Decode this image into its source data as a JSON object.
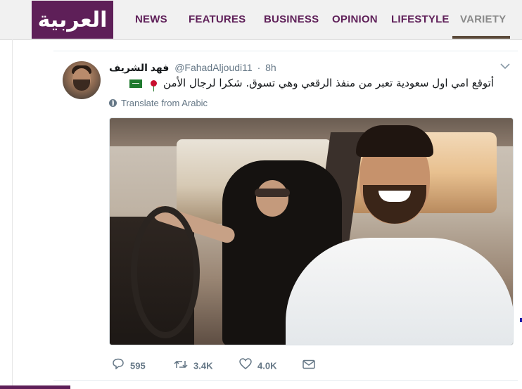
{
  "site": {
    "logo_text": "العربية",
    "brand_color": "#5e1f58"
  },
  "nav": {
    "items": [
      {
        "label": "NEWS"
      },
      {
        "label": "FEATURES"
      },
      {
        "label": "BUSINESS"
      },
      {
        "label": "OPINION"
      },
      {
        "label": "LIFESTYLE"
      },
      {
        "label": "VARIETY"
      }
    ],
    "active": "VARIETY"
  },
  "tweet": {
    "display_name": "فهد الشريف",
    "handle": "@FahadAljoudi11",
    "separator": "·",
    "time": "8h",
    "text": "أتوقع امي اول سعودية تعبر من منفذ الرقعي وهي تسوق. شكرا لرجال الأمن",
    "translate_label": "Translate from Arabic",
    "icons": {
      "caret": "chevron-down-icon",
      "emoji_rose": "rose-emoji",
      "emoji_flag": "saudi-flag-emoji",
      "translate": "globe-icon"
    },
    "actions": {
      "replies": "595",
      "retweets": "3.4K",
      "likes": "4.0K"
    }
  }
}
